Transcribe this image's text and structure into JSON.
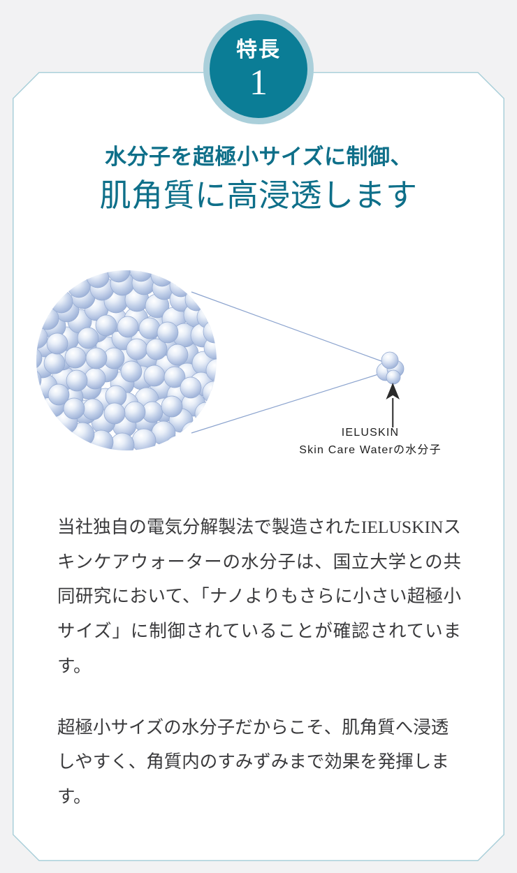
{
  "page": {
    "background_color": "#f2f2f3",
    "card_background": "#ffffff",
    "card_border_color": "#a9cfd9",
    "accent_teal": "#0b7d96",
    "headline_color": "#0e6f89",
    "body_text_color": "#3a3a3c",
    "molecule_blue": "#8ba3ce"
  },
  "badge": {
    "label": "特長",
    "number": "1",
    "fill_color": "#0b7d96",
    "ring_color": "#aacfda"
  },
  "headline": {
    "line1": "水分子を超極小サイズに制御、",
    "line2": "肌角質に高浸透します"
  },
  "illustration": {
    "name": "water-molecule-cluster-diagram",
    "large_cluster_label": "large water molecule cluster",
    "small_molecule_label": "ultra-small water molecule",
    "arrow_label": "pointer-arrow-up",
    "caption_line1": "IELUSKIN",
    "caption_line2": "Skin Care Waterの水分子"
  },
  "body": {
    "paragraph1": "当社独自の電気分解製法で製造されたIELUSKINスキンケアウォーターの水分子は、国立大学との共同研究において、「ナノよりもさらに小さい超極小サイズ」に制御されていることが確認されています。",
    "paragraph2": "超極小サイズの水分子だからこそ、肌角質へ浸透しやすく、角質内のすみずみまで効果を発揮します。"
  }
}
